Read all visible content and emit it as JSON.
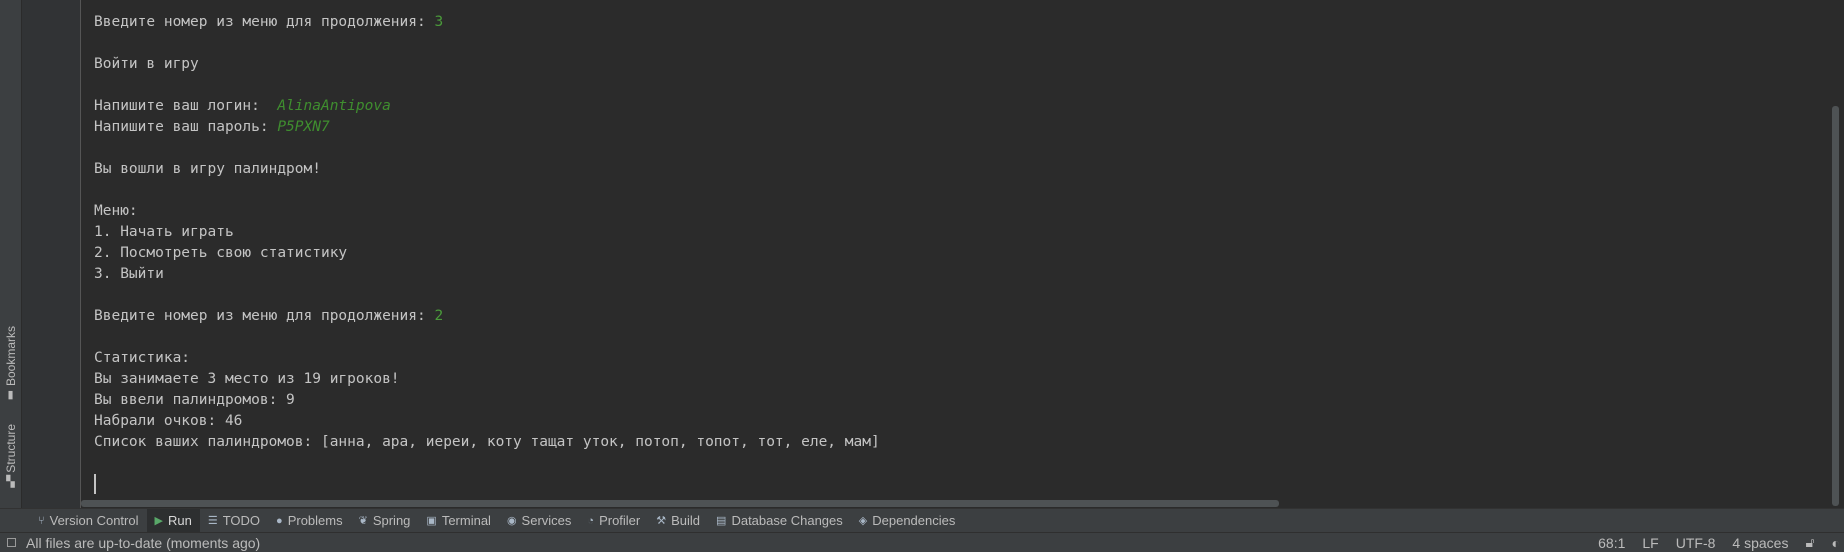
{
  "left_tabs": {
    "bookmarks": "Bookmarks",
    "structure": "Structure"
  },
  "console": {
    "lines": [
      {
        "text": "Введите номер из меню для продолжения: ",
        "input": "3"
      },
      {
        "text": ""
      },
      {
        "text": "Войти в игру"
      },
      {
        "text": ""
      },
      {
        "text": "Напишите ваш логин:  ",
        "input_italic": "AlinaAntipova"
      },
      {
        "text": "Напишите ваш пароль: ",
        "input_italic": "P5PXN7"
      },
      {
        "text": ""
      },
      {
        "text": "Вы вошли в игру палиндром!"
      },
      {
        "text": ""
      },
      {
        "text": "Меню:"
      },
      {
        "text": "1. Начать играть"
      },
      {
        "text": "2. Посмотреть свою статистику"
      },
      {
        "text": "3. Выйти"
      },
      {
        "text": ""
      },
      {
        "text": "Введите номер из меню для продолжения: ",
        "input": "2"
      },
      {
        "text": ""
      },
      {
        "text": "Статистика:"
      },
      {
        "text": "Вы занимаете 3 место из 19 игроков!"
      },
      {
        "text": "Вы ввели палиндромов: 9"
      },
      {
        "text": "Набрали очков: 46"
      },
      {
        "text": "Список ваших палиндромов: [анна, ара, иереи, коту тащат уток, потоп, топот, тот, еле, мам]"
      }
    ]
  },
  "toolbar": {
    "items": [
      {
        "label": "Version Control",
        "icon": "branch-icon",
        "glyph": "⑂"
      },
      {
        "label": "Run",
        "icon": "run-icon",
        "glyph": "▶",
        "active": true
      },
      {
        "label": "TODO",
        "icon": "list-icon",
        "glyph": "☰"
      },
      {
        "label": "Problems",
        "icon": "info-icon",
        "glyph": "●"
      },
      {
        "label": "Spring",
        "icon": "leaf-icon",
        "glyph": "❦"
      },
      {
        "label": "Terminal",
        "icon": "terminal-icon",
        "glyph": "▣"
      },
      {
        "label": "Services",
        "icon": "play-circle-icon",
        "glyph": "◉"
      },
      {
        "label": "Profiler",
        "icon": "profiler-icon",
        "glyph": "◔"
      },
      {
        "label": "Build",
        "icon": "hammer-icon",
        "glyph": "⚒"
      },
      {
        "label": "Database Changes",
        "icon": "database-icon",
        "glyph": "▤"
      },
      {
        "label": "Dependencies",
        "icon": "layers-icon",
        "glyph": "◈"
      }
    ]
  },
  "status": {
    "message": "All files are up-to-date (moments ago)",
    "position": "68:1",
    "line_separator": "LF",
    "encoding": "UTF-8",
    "indent": "4 spaces"
  },
  "colors": {
    "console_bg": "#2b2b2b",
    "panel_bg": "#3c3f41",
    "text": "#c4c4c4",
    "user_input": "#4a9a3a"
  }
}
